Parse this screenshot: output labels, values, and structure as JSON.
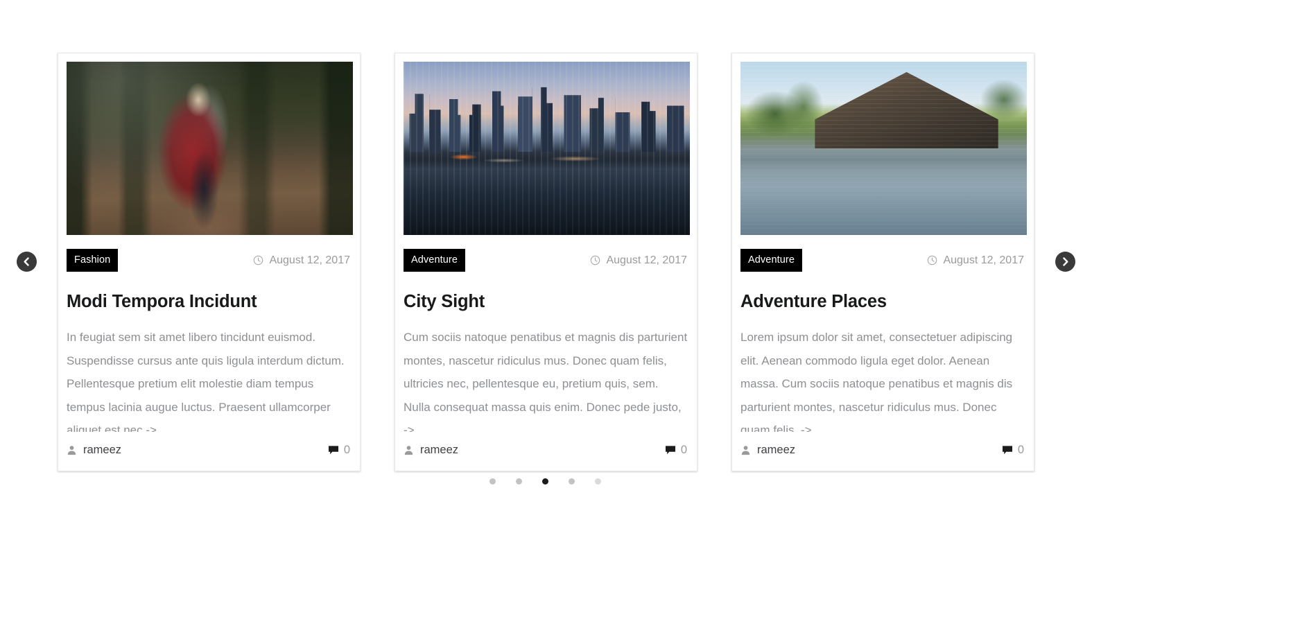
{
  "carousel": {
    "prev_label": "Previous slide",
    "next_label": "Next slide",
    "prev_icon": "chevron-left-icon",
    "next_icon": "chevron-right-icon",
    "active_dot_index": 2,
    "dot_count": 5,
    "dots": [
      "1",
      "2",
      "3",
      "4",
      "5"
    ]
  },
  "icons": {
    "clock": "clock-icon",
    "user": "user-icon",
    "comment": "comment-icon"
  },
  "cards": [
    {
      "image_alt": "woman-in-plaid-shirt-forest",
      "category": "Fashion",
      "date": "August 12, 2017",
      "title": "Modi Tempora Incidunt",
      "excerpt": "In feugiat sem sit amet libero tincidunt euismod. Suspendisse cursus ante quis ligula interdum dictum. Pellentesque pretium elit molestie diam tempus tempus lacinia augue luctus. Praesent ullamcorper aliquet est nec ->",
      "author": "rameez",
      "comment_count": "0"
    },
    {
      "image_alt": "city-skyline-dusk-reflection",
      "category": "Adventure",
      "date": "August 12, 2017",
      "title": "City Sight",
      "excerpt": "Cum sociis natoque penatibus et magnis dis parturient montes, nascetur ridiculus mus. Donec quam felis, ultricies nec, pellentesque eu, pretium quis, sem. Nulla consequat massa quis enim. Donec pede justo, ->",
      "author": "rameez",
      "comment_count": "0"
    },
    {
      "image_alt": "resort-villa-pool-reflection",
      "category": "Adventure",
      "date": "August 12, 2017",
      "title": "Adventure Places",
      "excerpt": "Lorem ipsum dolor sit amet, consectetuer adipiscing elit. Aenean commodo ligula eget dolor. Aenean massa. Cum sociis natoque penatibus et magnis dis parturient montes, nascetur ridiculus mus. Donec quam felis, ->",
      "author": "rameez",
      "comment_count": "0"
    }
  ],
  "colors": {
    "badge_bg": "#000000",
    "badge_text": "#ffffff",
    "title": "#18191a",
    "body_text": "#8d8f92",
    "meta_text": "#9a9a9a",
    "nav_bg": "#3a3a3a",
    "dot_active": "#1b1b1b",
    "dot_inactive": "#c3c3c3",
    "card_bg": "#ffffff",
    "card_border": "#e8e8e8",
    "page_bg": "#ffffff"
  }
}
